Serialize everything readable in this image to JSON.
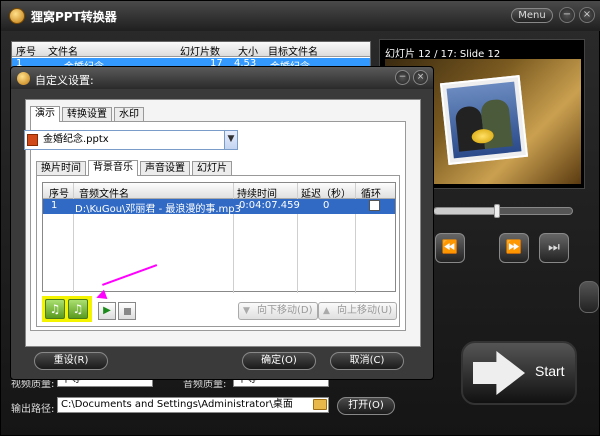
{
  "app": {
    "title": "狸窝PPT转换器",
    "menu_label": "Menu",
    "min_icon": "−",
    "close_icon": "×"
  },
  "file_table": {
    "headers": [
      "序号",
      "文件名",
      "幻灯片数",
      "大小",
      "目标文件名"
    ],
    "row": {
      "index": "1",
      "name": "金婚纪念",
      "slides": "17",
      "size": "4.53",
      "target": "金婚纪念"
    }
  },
  "preview": {
    "label": "幻灯片 12 / 17: Slide 12",
    "progress": 0.45
  },
  "player": {
    "rewind_icon": "⏪",
    "forward_icon": "⏩",
    "next_icon": "⏭"
  },
  "start_label": "Start",
  "bottom": {
    "video_quality_label": "视频质量:",
    "video_quality_value": "中等",
    "audio_quality_label": "音频质量:",
    "audio_quality_value": "中等",
    "output_label": "输出路径:",
    "output_path": "C:\\Documents and Settings\\Administrator\\桌面",
    "open_button": "打开(O)"
  },
  "dialog": {
    "title": "自定义设置:",
    "outer_tabs": [
      "演示",
      "转换设置",
      "水印"
    ],
    "ppt_file": "金婚纪念.pptx",
    "inner_tabs": [
      "换片时间",
      "背景音乐",
      "声音设置",
      "幻灯片"
    ],
    "grid": {
      "headers": [
        "序号",
        "音频文件名",
        "持续时间",
        "延迟（秒）",
        "循环"
      ],
      "rows": [
        {
          "index": "1",
          "file": "D:\\KuGou\\邓丽君 - 最浪漫的事.mp3",
          "duration": "0:04:07.459",
          "delay": "0"
        }
      ]
    },
    "move_down": "向下移动(D)",
    "move_up": "向上移动(U)",
    "reset": "重设(R)",
    "ok": "确定(O)",
    "cancel": "取消(C)"
  },
  "colors": {
    "accent": "#ff00ff",
    "highlight": "#f4f400",
    "selection": "#316ac5"
  }
}
